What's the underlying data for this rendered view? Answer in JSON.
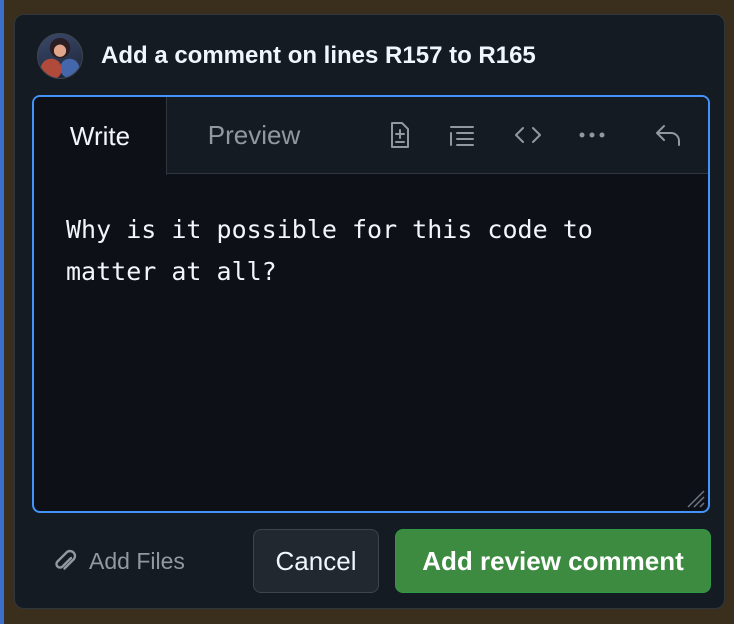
{
  "header": {
    "title": "Add a comment on lines R157 to R165",
    "avatar_icon": "user-avatar"
  },
  "editor": {
    "tabs": [
      {
        "label": "Write",
        "active": true
      },
      {
        "label": "Preview",
        "active": false
      }
    ],
    "toolbar_icons": [
      "file-diff-icon",
      "list-icon",
      "code-icon",
      "more-icon",
      "undo-icon"
    ],
    "text_value": "Why is it possible for this code to\nmatter at all?"
  },
  "footer": {
    "add_files_label": "Add Files",
    "cancel_label": "Cancel",
    "submit_label": "Add review comment"
  },
  "colors": {
    "accent_border": "#4493f8",
    "submit_bg": "#3d8a41",
    "card_bg": "#151b23",
    "editor_bg": "#0d1117"
  }
}
